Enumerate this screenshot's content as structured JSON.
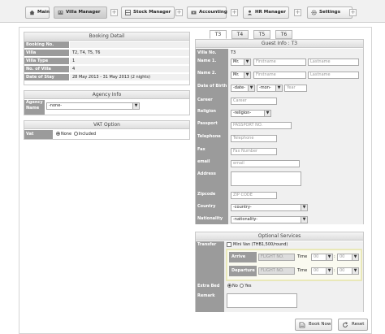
{
  "nav": {
    "tabs": [
      {
        "label": "Main",
        "icon": "home-icon"
      },
      {
        "label": "Villa Manager",
        "icon": "villa-icon"
      },
      {
        "label": "Stock Manager",
        "icon": "stock-icon"
      },
      {
        "label": "Accounting",
        "icon": "accounting-icon"
      },
      {
        "label": "HR Manager",
        "icon": "hr-icon"
      },
      {
        "label": "Settings",
        "icon": "gear-icon"
      }
    ],
    "plus": "+"
  },
  "booking": {
    "title": "Booking Detail",
    "rows": [
      {
        "label": "Booking No.",
        "value": ""
      },
      {
        "label": "Villa",
        "value": "T2, T4, T5, T6"
      },
      {
        "label": "Villa Type",
        "value": "1"
      },
      {
        "label": "No. of Villa",
        "value": "4"
      },
      {
        "label": "Date of Stay",
        "value": "28 May 2013 - 31 May 2013 (2 nights)"
      }
    ]
  },
  "agency": {
    "title": "Agency Info",
    "label": "Agency Name",
    "selected": "-none-"
  },
  "vat": {
    "title": "VAT Option",
    "label": "Vat",
    "option_none": "None",
    "option_included": "Included"
  },
  "guest": {
    "tabs": [
      "T3",
      "T4",
      "T5",
      "T6"
    ],
    "title": "Guest Info : T3",
    "villa_label": "Villa No.",
    "villa_value": "T3",
    "name1_label": "Name 1.",
    "name2_label": "Name 2.",
    "title_selected": "Mr.",
    "firstname_placeholder": "Firstname",
    "lastname_placeholder": "Lastname",
    "dob_label": "Date of Birth",
    "date_selected": "-date-",
    "month_selected": "-mon-",
    "year_placeholder": "Year",
    "career_label": "Career",
    "career_placeholder": "Career",
    "religion_label": "Religion",
    "religion_selected": "-religion-",
    "passport_label": "Passport",
    "passport_placeholder": "PASSPORT NO.",
    "telephone_label": "Telephone",
    "telephone_placeholder": "Telephone",
    "fax_label": "Fax",
    "fax_placeholder": "Fax Number",
    "email_label": "email",
    "email_placeholder": "email",
    "address_label": "Address",
    "zipcode_label": "Zipcode",
    "zipcode_placeholder": "ZIP CODE",
    "country_label": "Country",
    "country_selected": "-country-",
    "nationality_label": "Nationality",
    "nationality_selected": "-nationality-"
  },
  "services": {
    "title": "Optional Services",
    "transfer_label": "Transfer",
    "minivan_label": "Mini Van (THB1,500/round)",
    "arrive_label": "Arrive",
    "departure_label": "Departure",
    "flight_placeholder": "FLIGHT NO.",
    "time_label": "Time",
    "hour": "00",
    "minute": "00",
    "extra_bed_label": "Extra Bed",
    "extra_no": "No",
    "extra_yes": "Yes",
    "remark_label": "Remark"
  },
  "actions": {
    "book_now": "Book Now",
    "reset": "Reset"
  },
  "arrow": "▼"
}
